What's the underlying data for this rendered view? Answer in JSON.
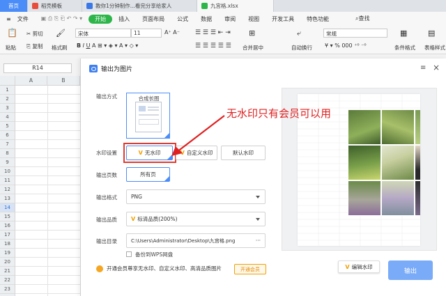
{
  "tabs": [
    {
      "label": "首页",
      "type": "home"
    },
    {
      "label": "稻壳模板",
      "type": "doc"
    },
    {
      "label": "教你1分钟制作...看完分享给家人",
      "type": "word"
    },
    {
      "label": "九宫格.xlsx",
      "type": "sheet"
    }
  ],
  "menu": {
    "file": "文件",
    "start": "开始",
    "items": [
      "插入",
      "页面布局",
      "公式",
      "数据",
      "审阅",
      "视图",
      "开发工具",
      "特色功能"
    ],
    "search": "查找"
  },
  "toolbar": {
    "paste": "粘贴",
    "cut": "剪切",
    "copy": "复制",
    "format_painter": "格式刷",
    "font": "宋体",
    "font_size": "11",
    "merge_center": "合并居中",
    "wrap": "自动换行",
    "number_format": "常规",
    "cond_format": "条件格式",
    "table_style": "表格样式"
  },
  "namebox": "R14",
  "sheet": {
    "columns": [
      "A",
      "B"
    ],
    "rows": [
      "1",
      "2",
      "3",
      "4",
      "5",
      "6",
      "7",
      "8",
      "9",
      "10",
      "11",
      "12",
      "13",
      "14",
      "15",
      "16",
      "17",
      "18",
      "19",
      "20",
      "21",
      "22",
      "23",
      "24"
    ],
    "selected_row": "14"
  },
  "dialog": {
    "title": "输出为图片",
    "output_mode_label": "输出方式",
    "output_mode_option": "合成长图",
    "watermark_label": "水印设置",
    "watermark_options": [
      "无水印",
      "自定义水印",
      "默认水印"
    ],
    "pages_label": "输出页数",
    "pages_option": "所有页",
    "format_label": "输出格式",
    "format_value": "PNG",
    "quality_label": "输出品质",
    "quality_value": "标清品质(200%)",
    "dir_label": "输出目录",
    "dir_value": "C:\\Users\\Administrator\\Desktop\\九宫格.png",
    "dir_more": "···",
    "backup_label": "备份到WPS网盘",
    "member_text": "开通会员尊享无水印、自定义水印、高清品质图片",
    "member_button": "开通会员",
    "edit_watermark": "编辑水印",
    "export_button": "输出",
    "vip_mark": "V"
  },
  "annotation": "无水印只有会员可以用",
  "colors": {
    "accent": "#4b8df8",
    "green_start": "#2db54a",
    "annotation_red": "#e02020",
    "vip_gold": "#f0a000",
    "export_button": "#7aabf8"
  }
}
